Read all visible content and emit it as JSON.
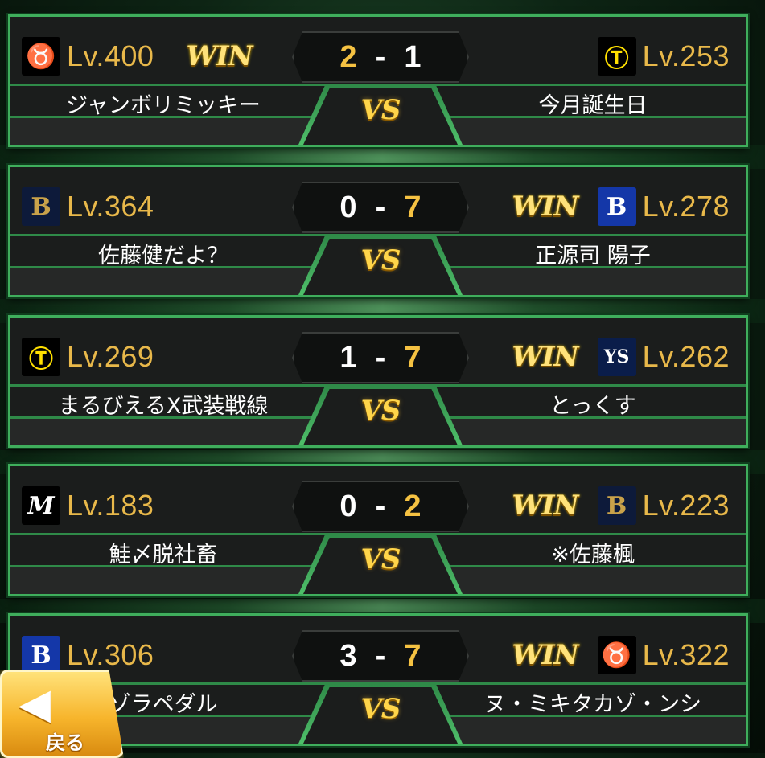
{
  "matches": [
    {
      "left": {
        "team_icon": "giants-icon",
        "logo_glyph": "♉",
        "level": "Lv.400",
        "name": "ジャンボリミッキー",
        "win": "WIN"
      },
      "right": {
        "team_icon": "tigers-icon",
        "logo_glyph": "Ⓣ",
        "level": "Lv.253",
        "name": "今月誕生日",
        "win": ""
      },
      "score_left": "2",
      "score_right": "1",
      "winner": "left",
      "vs": "VS"
    },
    {
      "left": {
        "team_icon": "buffaloes-icon",
        "logo_glyph": "B",
        "level": "Lv.364",
        "name": "佐藤健だよ？",
        "win": ""
      },
      "right": {
        "team_icon": "baystars-icon",
        "logo_glyph": "B",
        "level": "Lv.278",
        "name": "正源司 陽子",
        "win": "WIN"
      },
      "score_left": "0",
      "score_right": "7",
      "winner": "right",
      "vs": "VS"
    },
    {
      "left": {
        "team_icon": "tigers-icon",
        "logo_glyph": "Ⓣ",
        "level": "Lv.269",
        "name": "まるびえるX武装戦線",
        "win": ""
      },
      "right": {
        "team_icon": "swallows-icon",
        "logo_glyph": "YS",
        "level": "Lv.262",
        "name": "とっくす",
        "win": "WIN"
      },
      "score_left": "1",
      "score_right": "7",
      "winner": "right",
      "vs": "VS"
    },
    {
      "left": {
        "team_icon": "marines-icon",
        "logo_glyph": "M",
        "level": "Lv.183",
        "name": "鮭〆脱社畜",
        "win": ""
      },
      "right": {
        "team_icon": "buffaloes-icon",
        "logo_glyph": "B",
        "level": "Lv.223",
        "name": "※佐藤楓",
        "win": "WIN"
      },
      "score_left": "0",
      "score_right": "2",
      "winner": "right",
      "vs": "VS"
    },
    {
      "left": {
        "team_icon": "baystars-icon",
        "logo_glyph": "B",
        "level": "Lv.306",
        "name": "ゾラペダル",
        "win": ""
      },
      "right": {
        "team_icon": "giants-icon",
        "logo_glyph": "♉",
        "level": "Lv.322",
        "name": "ヌ・ミキタカゾ・ンシ",
        "win": "WIN"
      },
      "score_left": "3",
      "score_right": "7",
      "winner": "right",
      "vs": "VS"
    }
  ],
  "back_button": {
    "label": "戻る",
    "icon": "back-arrow-icon"
  },
  "colors": {
    "accent_green": "#3fae5c",
    "gold": "#f5c242",
    "level_text": "#e8b84a"
  }
}
